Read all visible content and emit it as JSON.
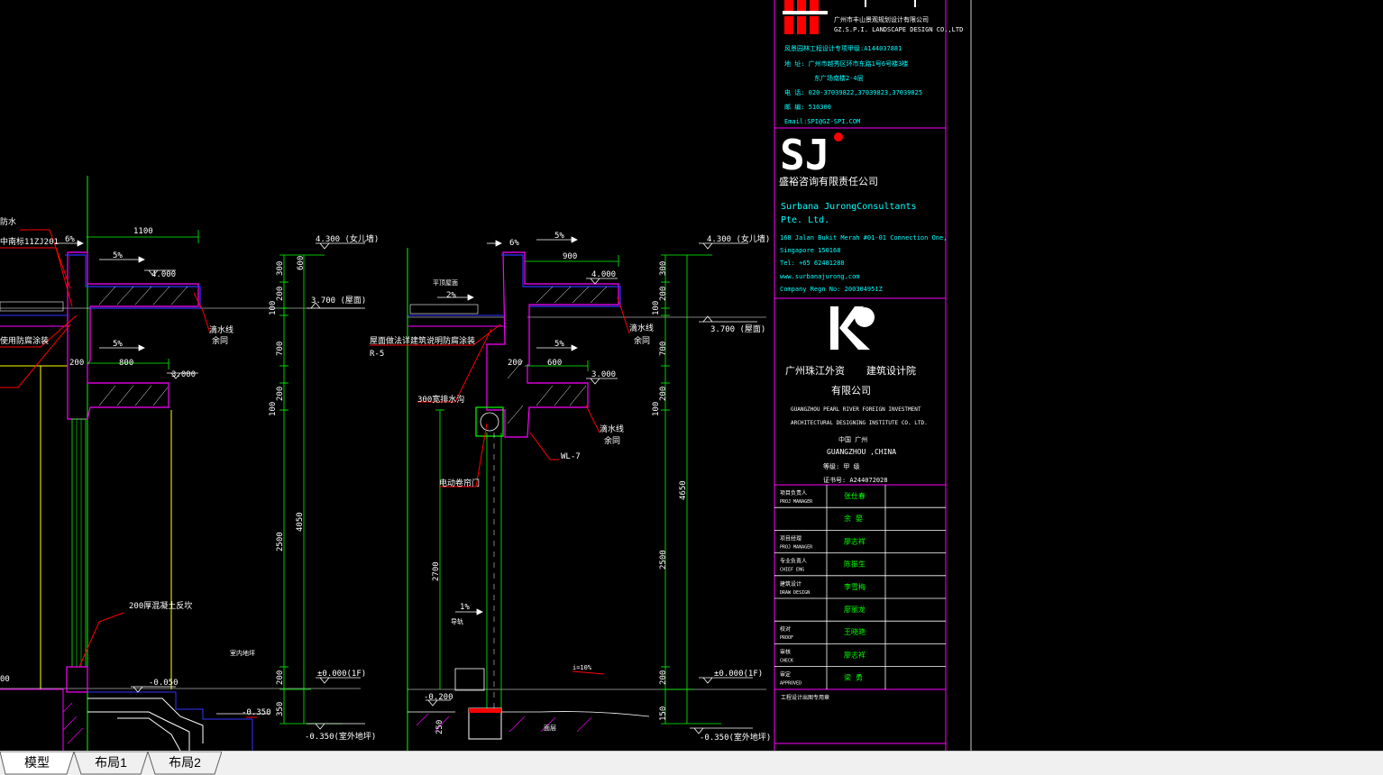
{
  "tabs": [
    {
      "label": "模型",
      "active": true
    },
    {
      "label": "布局1",
      "active": false
    },
    {
      "label": "布局2",
      "active": false
    }
  ],
  "colors": {
    "green": "#00ff00",
    "white": "#ffffff",
    "magenta": "#ff00ff",
    "blue": "#3333ff",
    "red": "#ff0000",
    "cyan": "#00ffff",
    "yellow": "#ffff00",
    "background": "#000000"
  },
  "drawing": {
    "left_section": {
      "elev_top": "4.300 (女儿墙)",
      "elev_roof": "3.700 (屋面)",
      "elev_ground": "±0.000(1F)",
      "elev_outdoor": "-0.350(室外地坪)",
      "slab_top": "4.000",
      "slab_mid": "3.000",
      "dim_1100": "1100",
      "dim_800": "800",
      "dim_200": "200",
      "slope_6": "6%",
      "slope_5a": "5%",
      "slope_5b": "5%",
      "note_drip": "滴水线",
      "note_drip2": "余同",
      "note_wall": "200厚混凝土反坎",
      "note_room": "室内地坪",
      "note_waterproof": "防水",
      "note_ref": "中南标11ZJ201",
      "note_material": "使用防腐涂装",
      "elev_neg005": "-0.050",
      "elev_neg035": "-0.350",
      "vdims": [
        "300",
        "600",
        "200",
        "100",
        "700",
        "200",
        "100",
        "2500",
        "4050",
        "200",
        "350"
      ],
      "left_edge_text": "00"
    },
    "right_section": {
      "elev_top": "4.300 (女儿墙)",
      "elev_roof": "3.700 (屋面)",
      "elev_ground": "±0.000(1F)",
      "elev_outdoor": "-0.350(室外地坪)",
      "slab_top": "4.000",
      "slab_mid": "3.000",
      "dim_900": "900",
      "dim_600": "600",
      "dim_200": "200",
      "slope_6": "6%",
      "slope_5a": "5%",
      "slope_5b": "5%",
      "slope_2": "2%",
      "slope_1": "1%",
      "note_gutter": "300宽排水沟",
      "note_rollingdoor": "电动卷帘门",
      "note_drip": "滴水线",
      "note_drip2": "余同",
      "note_wc": "WL-7",
      "note_r5": "R-5",
      "note_paint": "屋面做法详建筑说明防腐涂装",
      "note_guide": "导轨",
      "note_upper": "平顶屋面",
      "note_ramp": "i=10%",
      "elev_neg020": "-0.200",
      "dim_2700": "2700",
      "vdims": [
        "300",
        "200",
        "100",
        "700",
        "200",
        "100",
        "2500",
        "4650",
        "200",
        "150"
      ],
      "dim_250": "250",
      "note_end": "面层"
    },
    "title_block": {
      "firm1_name": "广州市丰山景观规划设计有限公司",
      "firm1_name_en": "GZ.S.P.I. LANDSCAPE DESIGN CO.,LTD",
      "firm1_license": "风景园林工程设计专项甲级:A144037881",
      "firm1_address": "地 址: 广州市越秀区环市东路1号6号楼3楼",
      "firm1_address2": "东广场南楼2-4层",
      "firm1_tel": "电 话: 020-37039822,37039823,37039825",
      "firm1_zip": "邮 编: 510300",
      "firm1_email": "Email:SPI@GZ-SPI.COM",
      "firm2_logo": "SJ",
      "firm2_name_cn": "盛裕咨询有限责任公司",
      "firm2_name_en1": "Surbana JurongConsultants",
      "firm2_name_en2": "Pte. Ltd.",
      "firm2_addr": "168 Jalan Bukit Merah #01-01 Connection One,",
      "firm2_addr2": "Singapore 150168",
      "firm2_tel": "Tel: +65 62481288",
      "firm2_web": "www.surbanajurong.com",
      "firm2_reg": "Company Regn No: 200304951Z",
      "firm3_name1": "广州珠江外资",
      "firm3_name2": "建筑设计院",
      "firm3_name3": "有限公司",
      "firm3_en1": "GUANGZHOU PEARL RIVER FOREIGN INVESTMENT",
      "firm3_en2": "ARCHITECTURAL DESIGNING INSTITUTE CO. LTD.",
      "firm3_loc": "中国  广州",
      "firm3_loc_en": "GUANGZHOU ,CHINA",
      "firm3_grade": "等级:      甲 级",
      "firm3_cert": "证书号:      A244072028",
      "rows": [
        {
          "label_cn": "项目负责人",
          "label_en": "PROJ MANAGER",
          "name": "张仕春"
        },
        {
          "label_cn": "",
          "label_en": "",
          "name": "余 晏"
        },
        {
          "label_cn": "项目经理",
          "label_en": "PROJ MANAGER",
          "name": "廖志祥"
        },
        {
          "label_cn": "专业负责人",
          "label_en": "CHIEF ENG",
          "name": "陈振生"
        },
        {
          "label_cn": "建筑设计",
          "label_en": "DRAW DESIGN",
          "name": "李雪梅"
        },
        {
          "label_cn": "",
          "label_en": "",
          "name": "廖丽龙"
        },
        {
          "label_cn": "校对",
          "label_en": "PROOF",
          "name": "王晓艳"
        },
        {
          "label_cn": "审核",
          "label_en": "CHECK",
          "name": "廖志祥"
        },
        {
          "label_cn": "审定",
          "label_en": "APPROVED",
          "name": "梁 勇"
        }
      ],
      "stamp_text": "工程设计出图专用章"
    }
  }
}
